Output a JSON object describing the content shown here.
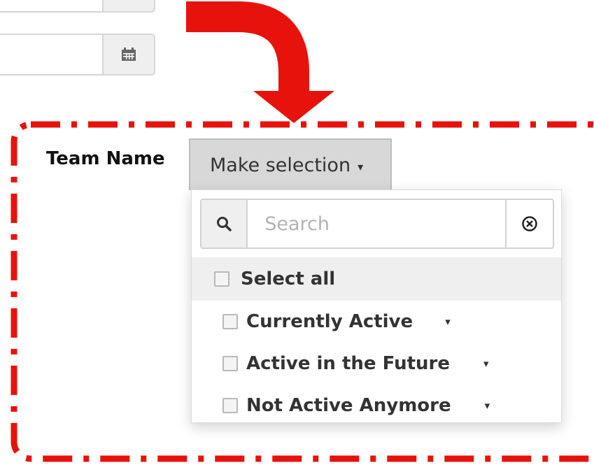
{
  "form": {
    "team_label": "Team Name"
  },
  "multiselect": {
    "button_label": "Make selection",
    "search_placeholder": "Search",
    "select_all_label": "Select all",
    "groups": [
      {
        "label": "Currently Active",
        "checked": false
      },
      {
        "label": "Active in the Future",
        "checked": false
      },
      {
        "label": "Not Active Anymore",
        "checked": false
      }
    ]
  },
  "icons": {
    "calendar": "calendar-icon",
    "search": "search-icon",
    "clear": "clear-circle-icon",
    "caret": "caret-down-icon"
  },
  "colors": {
    "annotation_red": "#e8120c",
    "button_bg": "#d8d8d8",
    "select_all_bg": "#efefef"
  }
}
